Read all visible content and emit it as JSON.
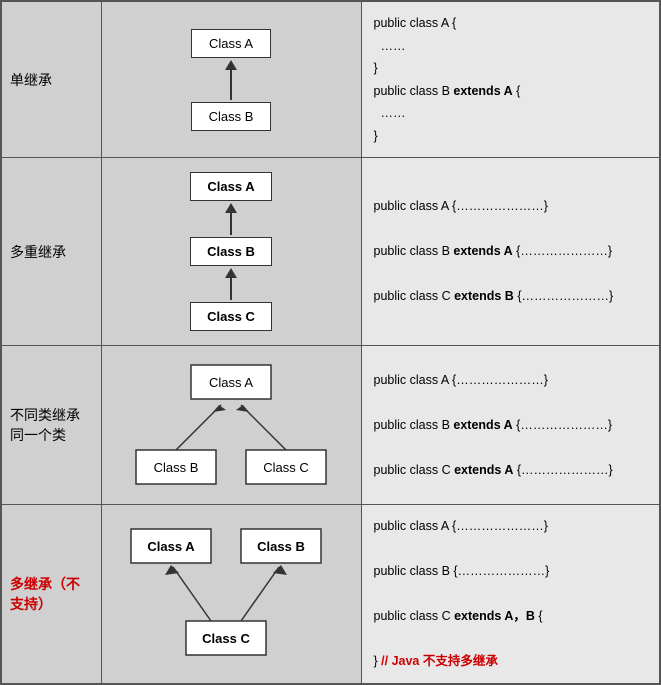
{
  "rows": [
    {
      "label": "单继承",
      "label_red": false,
      "code_lines": [
        {
          "text": "public class A {",
          "parts": [
            {
              "t": "public class A {",
              "bold": false
            }
          ]
        },
        {
          "text": "……",
          "parts": [
            {
              "t": "……",
              "bold": false
            }
          ]
        },
        {
          "text": "}",
          "parts": [
            {
              "t": "}",
              "bold": false
            }
          ]
        },
        {
          "text": "public class B extends A {",
          "parts": [
            {
              "t": "public class B ",
              "bold": false
            },
            {
              "t": "extends A",
              "bold": true
            },
            {
              "t": " {",
              "bold": false
            }
          ]
        },
        {
          "text": "……",
          "parts": [
            {
              "t": "……",
              "bold": false
            }
          ]
        },
        {
          "text": "}",
          "parts": [
            {
              "t": "}",
              "bold": false
            }
          ]
        }
      ],
      "diagram_type": "single"
    },
    {
      "label": "多重继承",
      "label_red": false,
      "code_lines": [
        {
          "parts": [
            {
              "t": "public class A {…………………}",
              "bold": false
            }
          ]
        },
        {
          "parts": []
        },
        {
          "parts": [
            {
              "t": "public class B ",
              "bold": false
            },
            {
              "t": "extends A",
              "bold": true
            },
            {
              "t": " {…………………}",
              "bold": false
            }
          ]
        },
        {
          "parts": []
        },
        {
          "parts": [
            {
              "t": "public class C ",
              "bold": false
            },
            {
              "t": "extends B",
              "bold": true
            },
            {
              "t": " {…………………}",
              "bold": false
            }
          ]
        }
      ],
      "diagram_type": "multi"
    },
    {
      "label": "不同类继承同一个类",
      "label_red": false,
      "code_lines": [
        {
          "parts": [
            {
              "t": "public class A {…………………}",
              "bold": false
            }
          ]
        },
        {
          "parts": []
        },
        {
          "parts": [
            {
              "t": "public class B ",
              "bold": false
            },
            {
              "t": "extends A",
              "bold": true
            },
            {
              "t": " {…………………}",
              "bold": false
            }
          ]
        },
        {
          "parts": []
        },
        {
          "parts": [
            {
              "t": "public class C ",
              "bold": false
            },
            {
              "t": "extends A",
              "bold": true
            },
            {
              "t": " {…………………}",
              "bold": false
            }
          ]
        }
      ],
      "diagram_type": "fork"
    },
    {
      "label": "多继承（不支持）",
      "label_red": true,
      "code_lines": [
        {
          "parts": [
            {
              "t": "public class A {…………………}",
              "bold": false
            }
          ]
        },
        {
          "parts": []
        },
        {
          "parts": [
            {
              "t": "public class B {…………………}",
              "bold": false
            }
          ]
        },
        {
          "parts": []
        },
        {
          "parts": [
            {
              "t": "public class C ",
              "bold": false
            },
            {
              "t": "extends A，B",
              "bold": true
            },
            {
              "t": " {",
              "bold": false
            }
          ]
        },
        {
          "parts": []
        },
        {
          "parts": [
            {
              "t": "} ",
              "bold": false
            },
            {
              "t": "// Java 不支持多继承",
              "bold": false,
              "red": true
            }
          ]
        }
      ],
      "diagram_type": "diamond"
    }
  ]
}
